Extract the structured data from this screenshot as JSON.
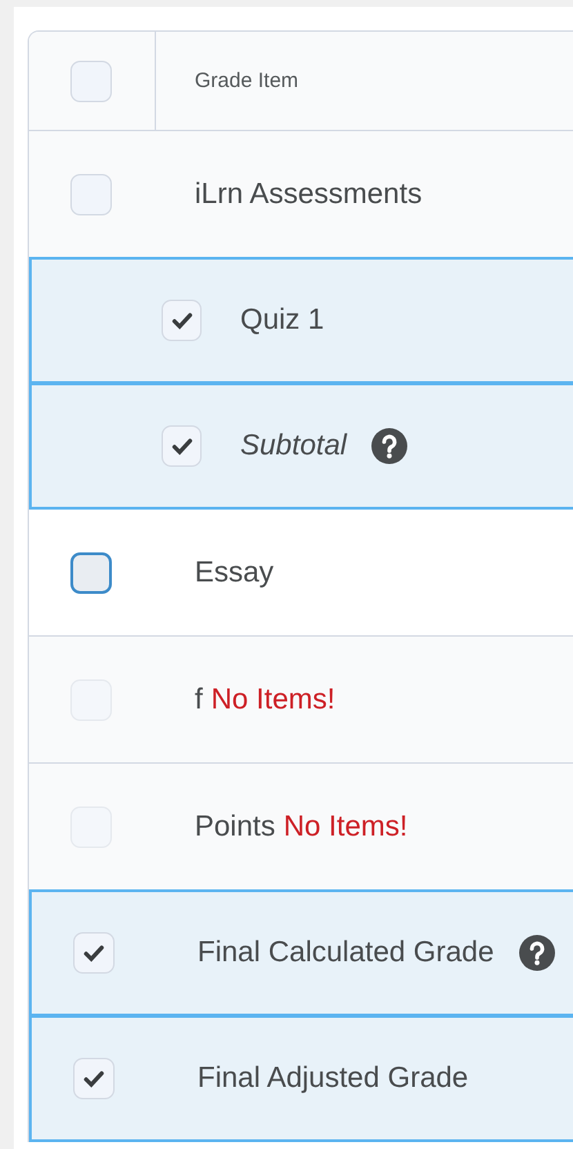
{
  "table": {
    "header": {
      "label": "Grade Item",
      "checked": false
    },
    "rows": [
      {
        "italic": false,
        "label": "iLrn Assessments",
        "help": false,
        "checked": false,
        "selected": false,
        "disabled": false,
        "focused": false,
        "children": [
          {
            "italic": false,
            "label": "Quiz 1",
            "checked": true,
            "selected": true,
            "disabled": false,
            "focused": false,
            "help": false
          },
          {
            "italic": true,
            "label": "Subtotal",
            "checked": true,
            "selected": true,
            "disabled": false,
            "focused": false,
            "help": true
          }
        ]
      },
      {
        "italic": false,
        "label": "Essay",
        "checked": false,
        "selected": false,
        "disabled": false,
        "focused": true,
        "help": false
      },
      {
        "italic": false,
        "label": "f",
        "help": false,
        "warning": "No Items!",
        "checked": false,
        "selected": false,
        "disabled": true,
        "focused": false
      },
      {
        "italic": false,
        "label": "Points",
        "help": false,
        "warning": "No Items!",
        "checked": false,
        "selected": false,
        "disabled": true,
        "focused": false
      },
      {
        "italic": false,
        "label": "Final Calculated Grade",
        "checked": true,
        "selected": true,
        "disabled": false,
        "focused": false,
        "help": true
      },
      {
        "italic": false,
        "label": "Final Adjusted Grade",
        "checked": true,
        "selected": true,
        "disabled": false,
        "focused": false,
        "help": false
      }
    ]
  }
}
